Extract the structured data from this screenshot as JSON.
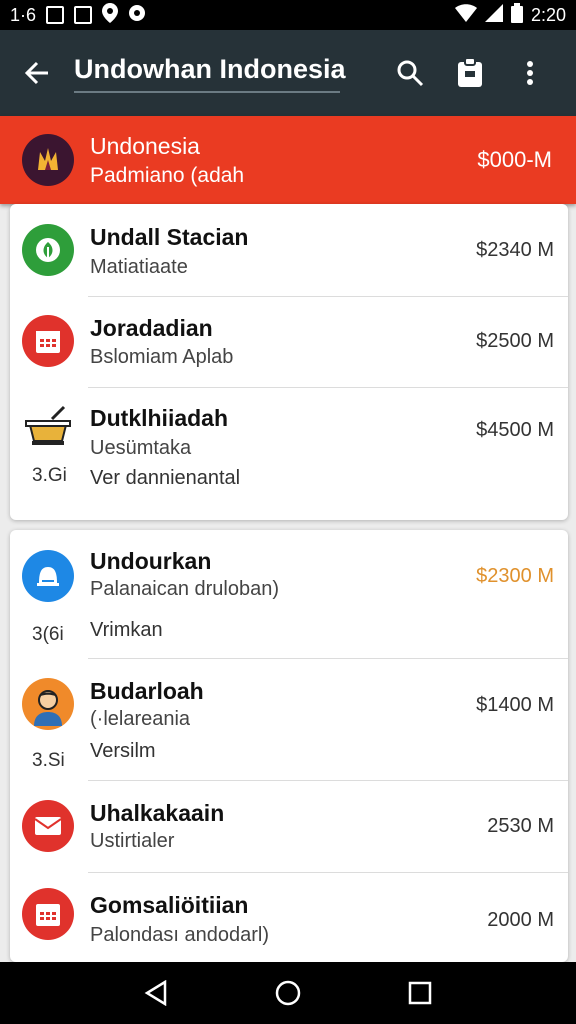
{
  "status_bar": {
    "left_text": "1·6",
    "time": "2:20",
    "icons": [
      "image-icon",
      "photo-icon",
      "location-icon",
      "record-icon",
      "wifi-icon",
      "signal-icon",
      "battery-icon"
    ]
  },
  "app_bar": {
    "title": "Undowhan Indonesia",
    "icons": [
      "back-arrow-icon",
      "search-icon",
      "clipboard-icon",
      "more-vert-icon"
    ]
  },
  "banner": {
    "title": "Undonesia",
    "subtitle": "Padmiano (adah",
    "value": "$000-M",
    "color": "#ea3b22",
    "icon": "crown-emblem-icon"
  },
  "groups": [
    {
      "items": [
        {
          "title": "Undall Stacian",
          "subtitle": "Matiatiaate",
          "value": "$2340 M",
          "icon": "leaf-icon",
          "icon_color": "#2e9e3a"
        },
        {
          "title": "Joradadian",
          "subtitle": "Bslomiam Aplab",
          "value": "$2500 M",
          "icon": "calendar-icon",
          "icon_color": "#e0322c"
        },
        {
          "title": "Dutklhiiadah",
          "subtitle": "Uesümtaka",
          "value": "$4500 M",
          "icon": "cauldron-icon",
          "icon_color": "#e8b23a",
          "code": "3.Gi",
          "note": "Ver dannienantal"
        }
      ]
    },
    {
      "items": [
        {
          "title": "Undourkan",
          "subtitle": "Palanaican druloban)",
          "value": "$2300 M",
          "value_color": "#e0912c",
          "icon": "bell-icon",
          "icon_color": "#1e88e5",
          "code": "3(6i",
          "note": "Vrimkan"
        },
        {
          "title": "Budarloah",
          "subtitle": "(·lelareania",
          "value": "$1400 M",
          "icon": "person-avatar-icon",
          "icon_color": "#f08a2a",
          "code": "3.Si",
          "note": "Versilm"
        },
        {
          "title": "Uhalkakaain",
          "subtitle": "Ustirtialer",
          "value": "2530 M",
          "icon": "envelope-icon",
          "icon_color": "#e0322c"
        },
        {
          "title": "Gomsaliöitiian",
          "subtitle": "Palondası andodarl)",
          "value": "2000 M",
          "icon": "calendar-icon",
          "icon_color": "#e0322c"
        }
      ]
    }
  ],
  "nav_bar": {
    "icons": [
      "back-triangle-icon",
      "home-circle-icon",
      "recents-square-icon"
    ]
  }
}
